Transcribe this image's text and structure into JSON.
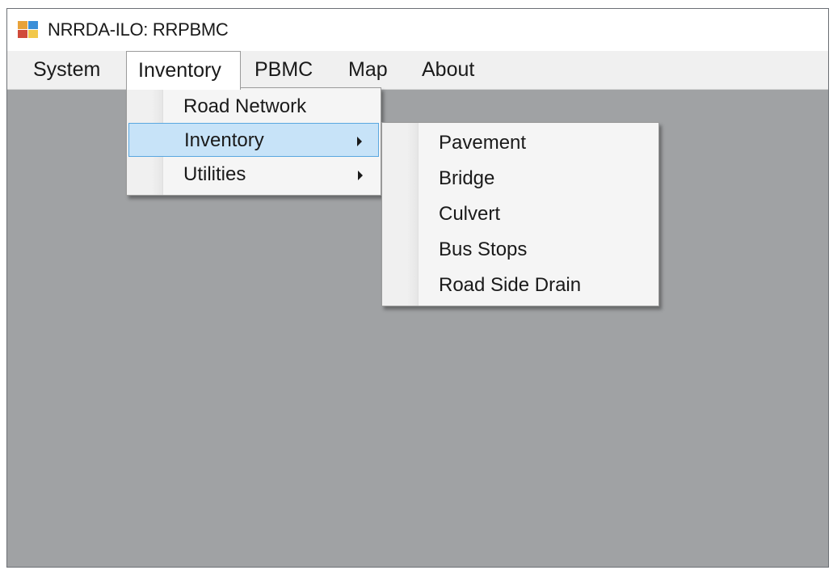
{
  "window": {
    "title": "NRRDA-ILO: RRPBMC"
  },
  "menubar": {
    "items": [
      "System",
      "Inventory",
      "PBMC",
      "Map",
      "About"
    ],
    "open_item": "Inventory"
  },
  "inventory_menu": {
    "items": [
      {
        "label": "Road Network",
        "has_submenu": false
      },
      {
        "label": "Inventory",
        "has_submenu": true,
        "highlighted": true
      },
      {
        "label": "Utilities",
        "has_submenu": true
      }
    ]
  },
  "inventory_submenu": {
    "items": [
      "Pavement",
      "Bridge",
      "Culvert",
      "Bus Stops",
      "Road Side Drain"
    ]
  },
  "colors": {
    "client_area": "#a0a2a4",
    "menu_highlight": "#c7e3f8",
    "menu_highlight_border": "#5aa7e0"
  },
  "icons": {
    "app": "windows-forms-app-icon",
    "submenu_arrow": "chevron-right-icon"
  }
}
